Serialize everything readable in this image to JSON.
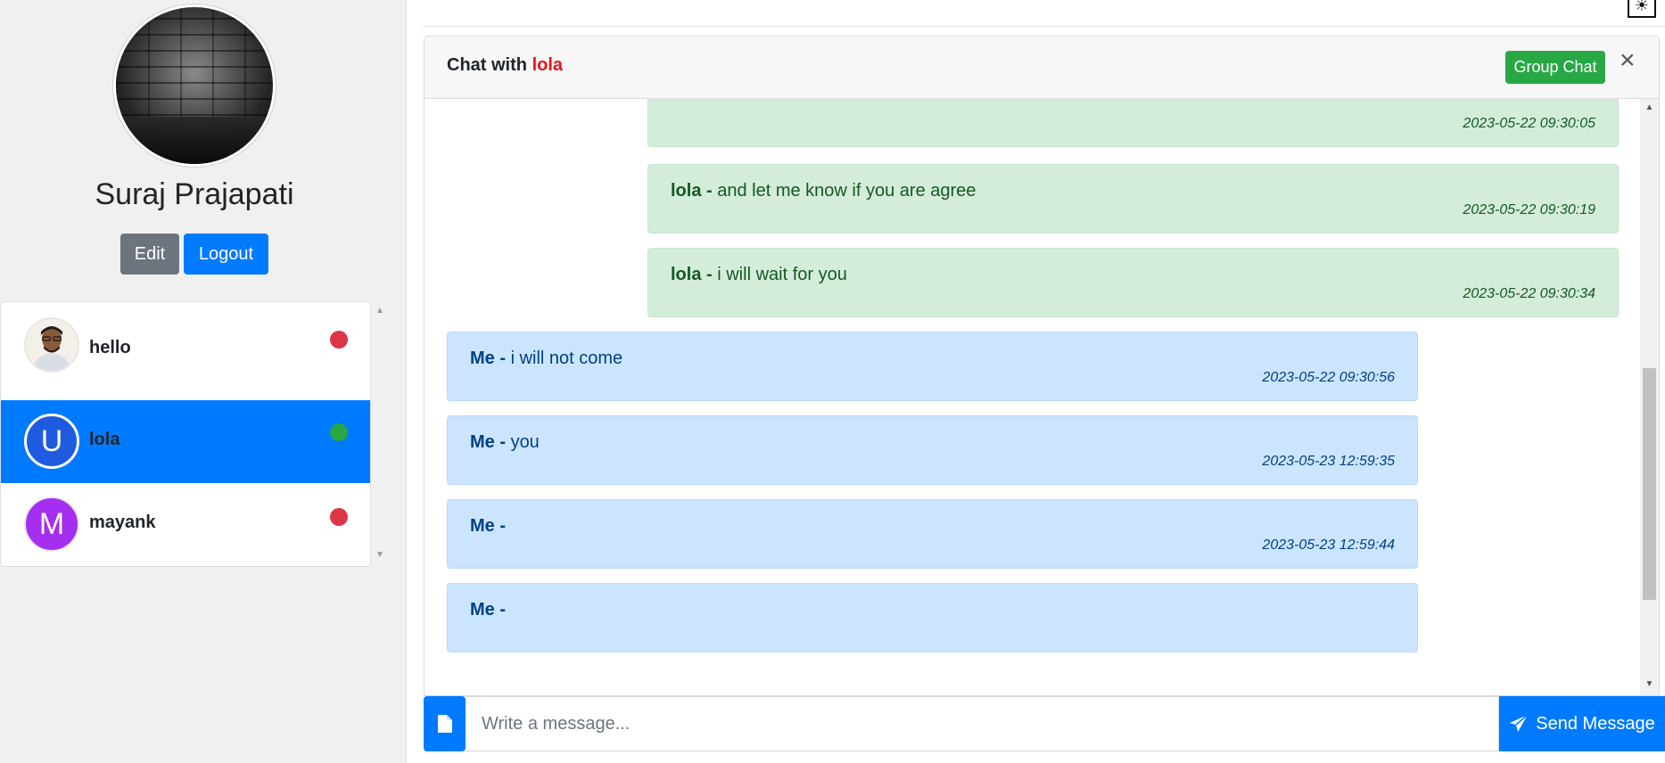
{
  "profile": {
    "name": "Suraj Prajapati",
    "edit_label": "Edit",
    "logout_label": "Logout"
  },
  "users": [
    {
      "name": "hello",
      "avatar_letter": "",
      "avatar_type": "photo",
      "status": "offline",
      "status_color": "#dc3545",
      "active": false
    },
    {
      "name": "lola",
      "avatar_letter": "U",
      "avatar_color": "#1f5be0",
      "status": "online",
      "status_color": "#28a745",
      "active": true
    },
    {
      "name": "mayank",
      "avatar_letter": "M",
      "avatar_color": "#a52ff0",
      "status": "offline",
      "status_color": "#dc3545",
      "active": false
    }
  ],
  "chat": {
    "title_prefix": "Chat with",
    "title_user": "lola",
    "group_chat_label": "Group Chat",
    "close_icon": "close-icon",
    "messages": [
      {
        "direction": "incoming",
        "sender": "",
        "text": "",
        "time": "2023-05-22 09:30:05"
      },
      {
        "direction": "incoming",
        "sender": "lola -",
        "text": "and let me know if you are agree",
        "time": "2023-05-22 09:30:19"
      },
      {
        "direction": "incoming",
        "sender": "lola -",
        "text": "i will wait for you",
        "time": "2023-05-22 09:30:34"
      },
      {
        "direction": "outgoing",
        "sender": "Me -",
        "text": "i will not come",
        "time": "2023-05-22 09:30:56"
      },
      {
        "direction": "outgoing",
        "sender": "Me -",
        "text": "you",
        "time": "2023-05-23 12:59:35"
      },
      {
        "direction": "outgoing",
        "sender": "Me -",
        "text": "",
        "time": "2023-05-23 12:59:44"
      },
      {
        "direction": "outgoing",
        "sender": "Me -",
        "text": "",
        "time": ""
      }
    ]
  },
  "composer": {
    "placeholder": "Write a message...",
    "send_label": "Send Message",
    "attach_icon": "file-icon",
    "send_icon": "paper-plane-icon"
  },
  "colors": {
    "primary": "#007bff",
    "success": "#28a745",
    "secondary": "#6c757d",
    "danger": "#dc3545",
    "incoming_bg": "#d4edda",
    "outgoing_bg": "#cce5ff"
  }
}
